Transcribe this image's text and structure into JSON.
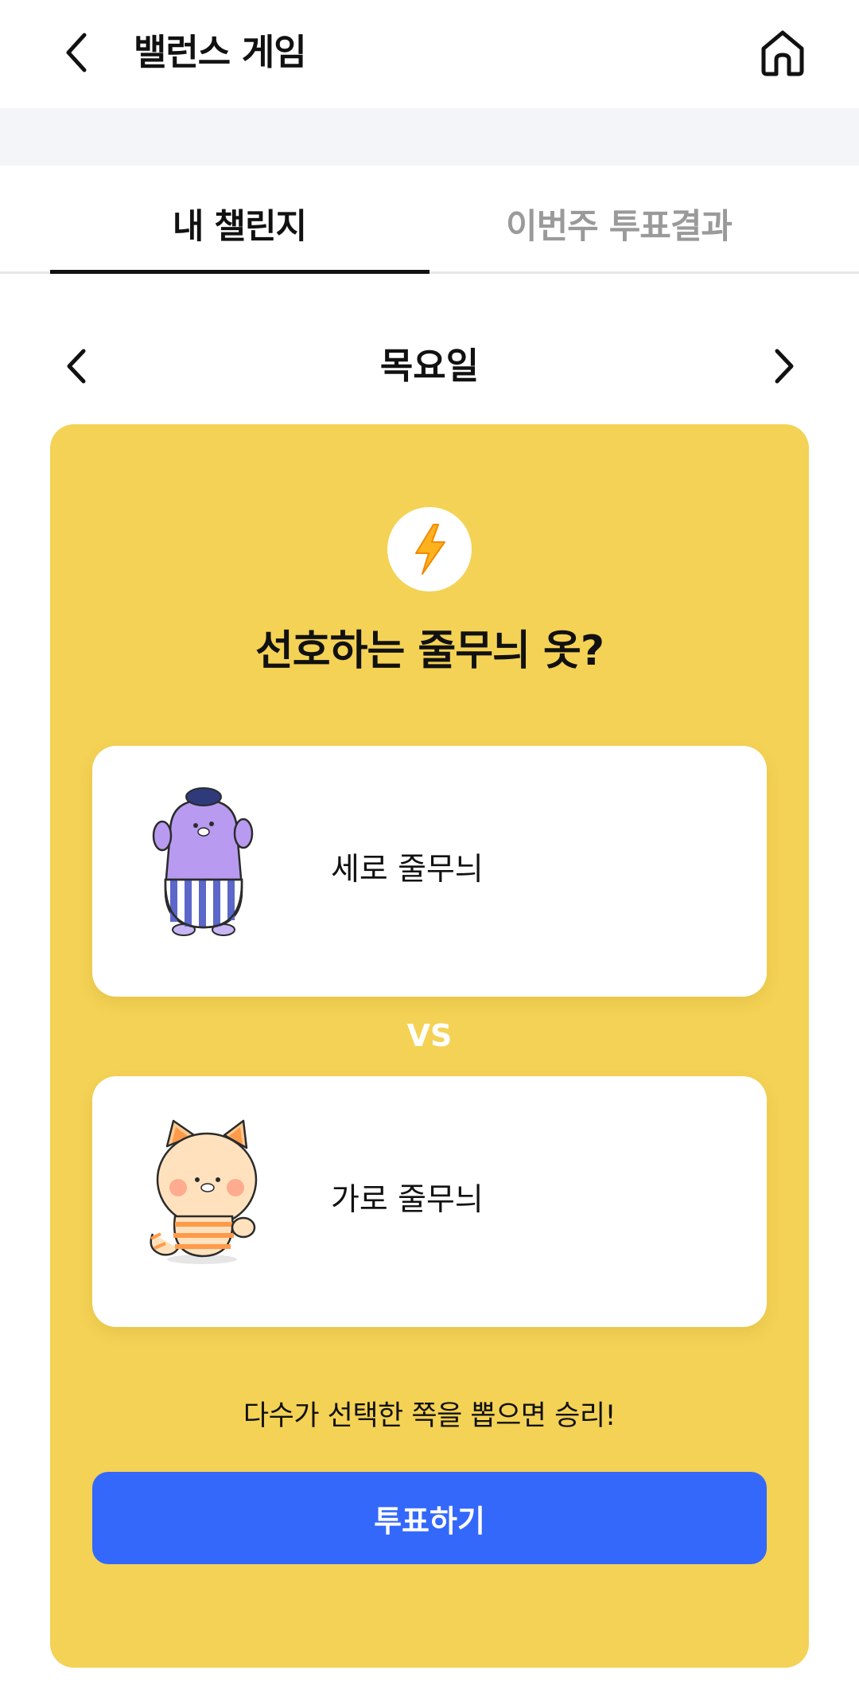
{
  "header": {
    "title": "밸런스 게임",
    "back_icon": "chevron-left-icon",
    "home_icon": "home-icon"
  },
  "tabs": [
    {
      "label": "내 챌린지",
      "active": true
    },
    {
      "label": "이번주 투표결과",
      "active": false
    }
  ],
  "day_nav": {
    "label": "목요일",
    "prev_icon": "chevron-left-icon",
    "next_icon": "chevron-right-icon"
  },
  "challenge": {
    "badge_icon": "lightning-bolt-icon",
    "question": "선호하는 줄무늬 옷?",
    "vs_label": "VS",
    "options": [
      {
        "label": "세로 줄무늬",
        "image": "purple-character-vertical-stripes"
      },
      {
        "label": "가로 줄무늬",
        "image": "cat-character-horizontal-stripes"
      }
    ],
    "hint": "다수가 선택한 쪽을 뽑으면 승리!",
    "vote_button": "투표하기"
  },
  "colors": {
    "card_background": "#f4d255",
    "vote_button": "#3468fb",
    "tab_inactive": "#9a9a9a",
    "band": "#f4f5f8"
  }
}
